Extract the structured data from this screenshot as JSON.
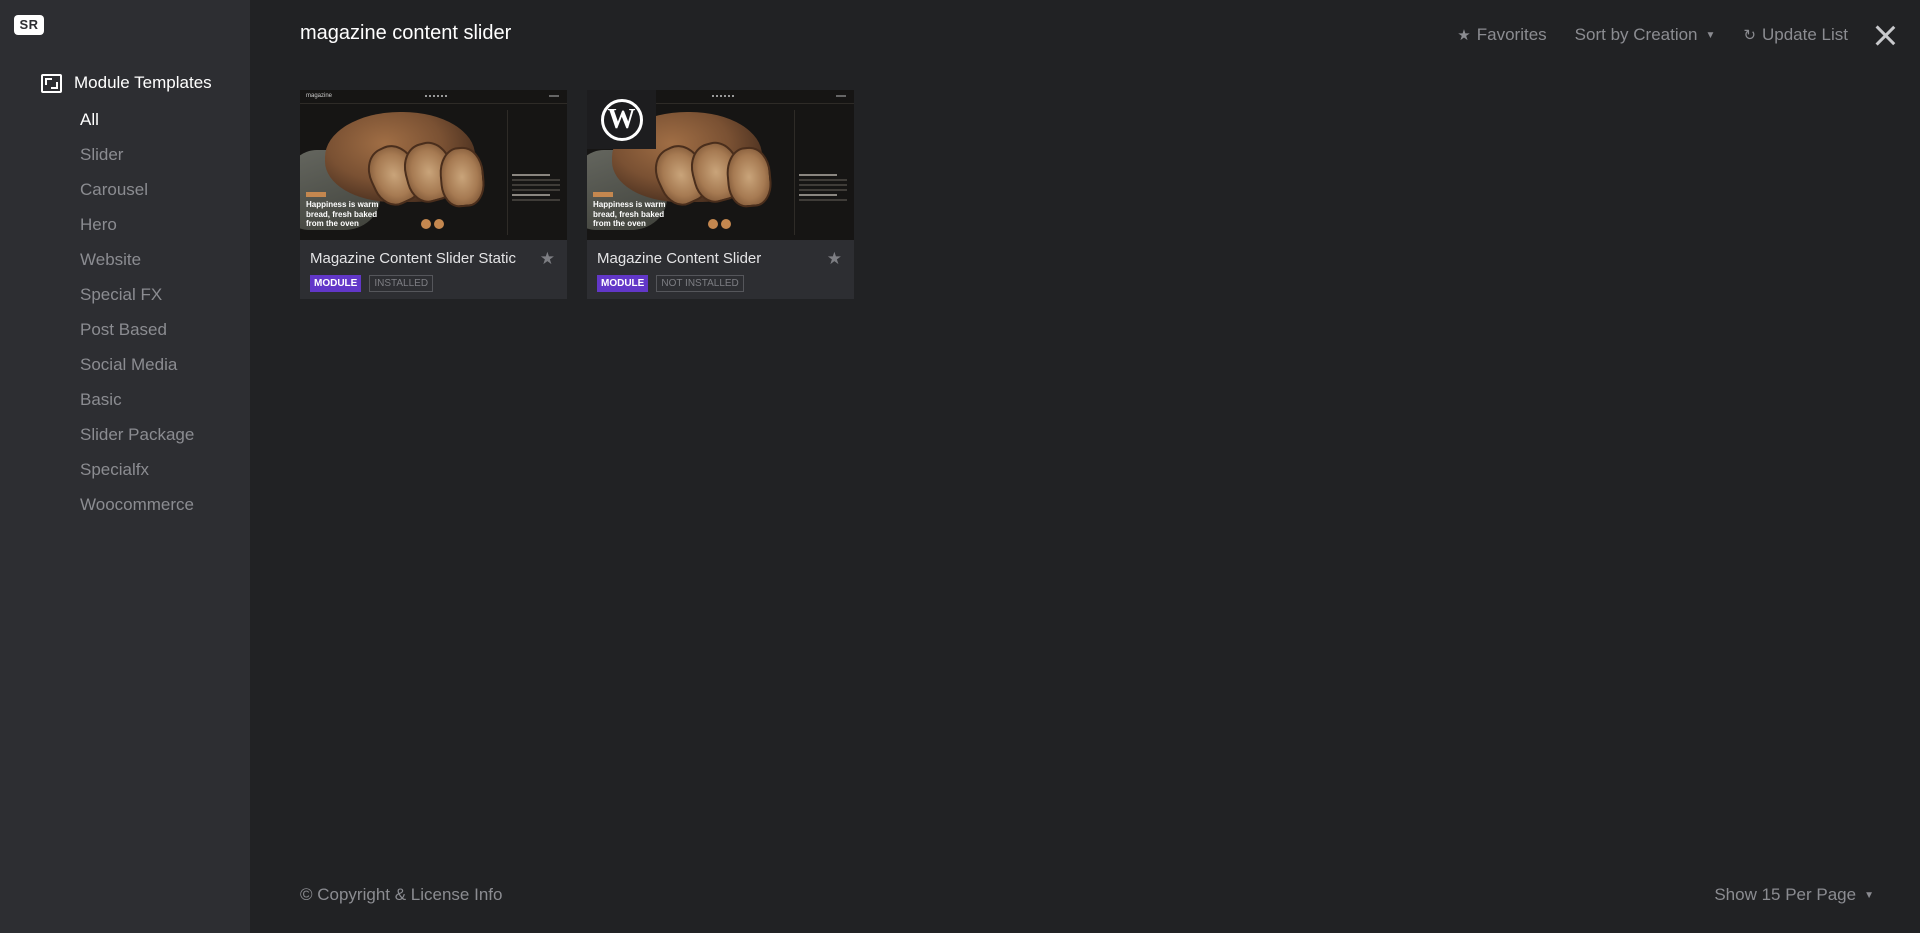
{
  "logo": {
    "text": "SR"
  },
  "sidebar": {
    "section_title": "Module Templates",
    "section_icon": "module-templates-icon",
    "categories": [
      {
        "label": "All",
        "active": true
      },
      {
        "label": "Slider"
      },
      {
        "label": "Carousel"
      },
      {
        "label": "Hero"
      },
      {
        "label": "Website"
      },
      {
        "label": "Special FX"
      },
      {
        "label": "Post Based"
      },
      {
        "label": "Social Media"
      },
      {
        "label": "Basic"
      },
      {
        "label": "Slider Package"
      },
      {
        "label": "Specialfx"
      },
      {
        "label": "Woocommerce"
      }
    ]
  },
  "header": {
    "search_title": "magazine content slider",
    "favorites_label": "Favorites",
    "sort_label": "Sort by Creation",
    "update_label": "Update List"
  },
  "cards": [
    {
      "title": "Magazine Content Slider Static",
      "type_badge": "MODULE",
      "status_badge": "INSTALLED",
      "thumb_brand": "magazine",
      "thumb_headline": "Happiness is warm bread, fresh baked from the oven",
      "wordpress_badge": false
    },
    {
      "title": "Magazine Content Slider",
      "type_badge": "MODULE",
      "status_badge": "NOT INSTALLED",
      "thumb_brand": "magazine",
      "thumb_headline": "Happiness is warm bread, fresh baked from the oven",
      "wordpress_badge": true
    }
  ],
  "footer": {
    "copyright": "© Copyright & License Info",
    "per_page": "Show 15 Per Page"
  },
  "colors": {
    "background": "#212224",
    "sidebar": "#2d2e32",
    "module_badge": "#6237c8",
    "muted_text": "#8b8c91"
  }
}
